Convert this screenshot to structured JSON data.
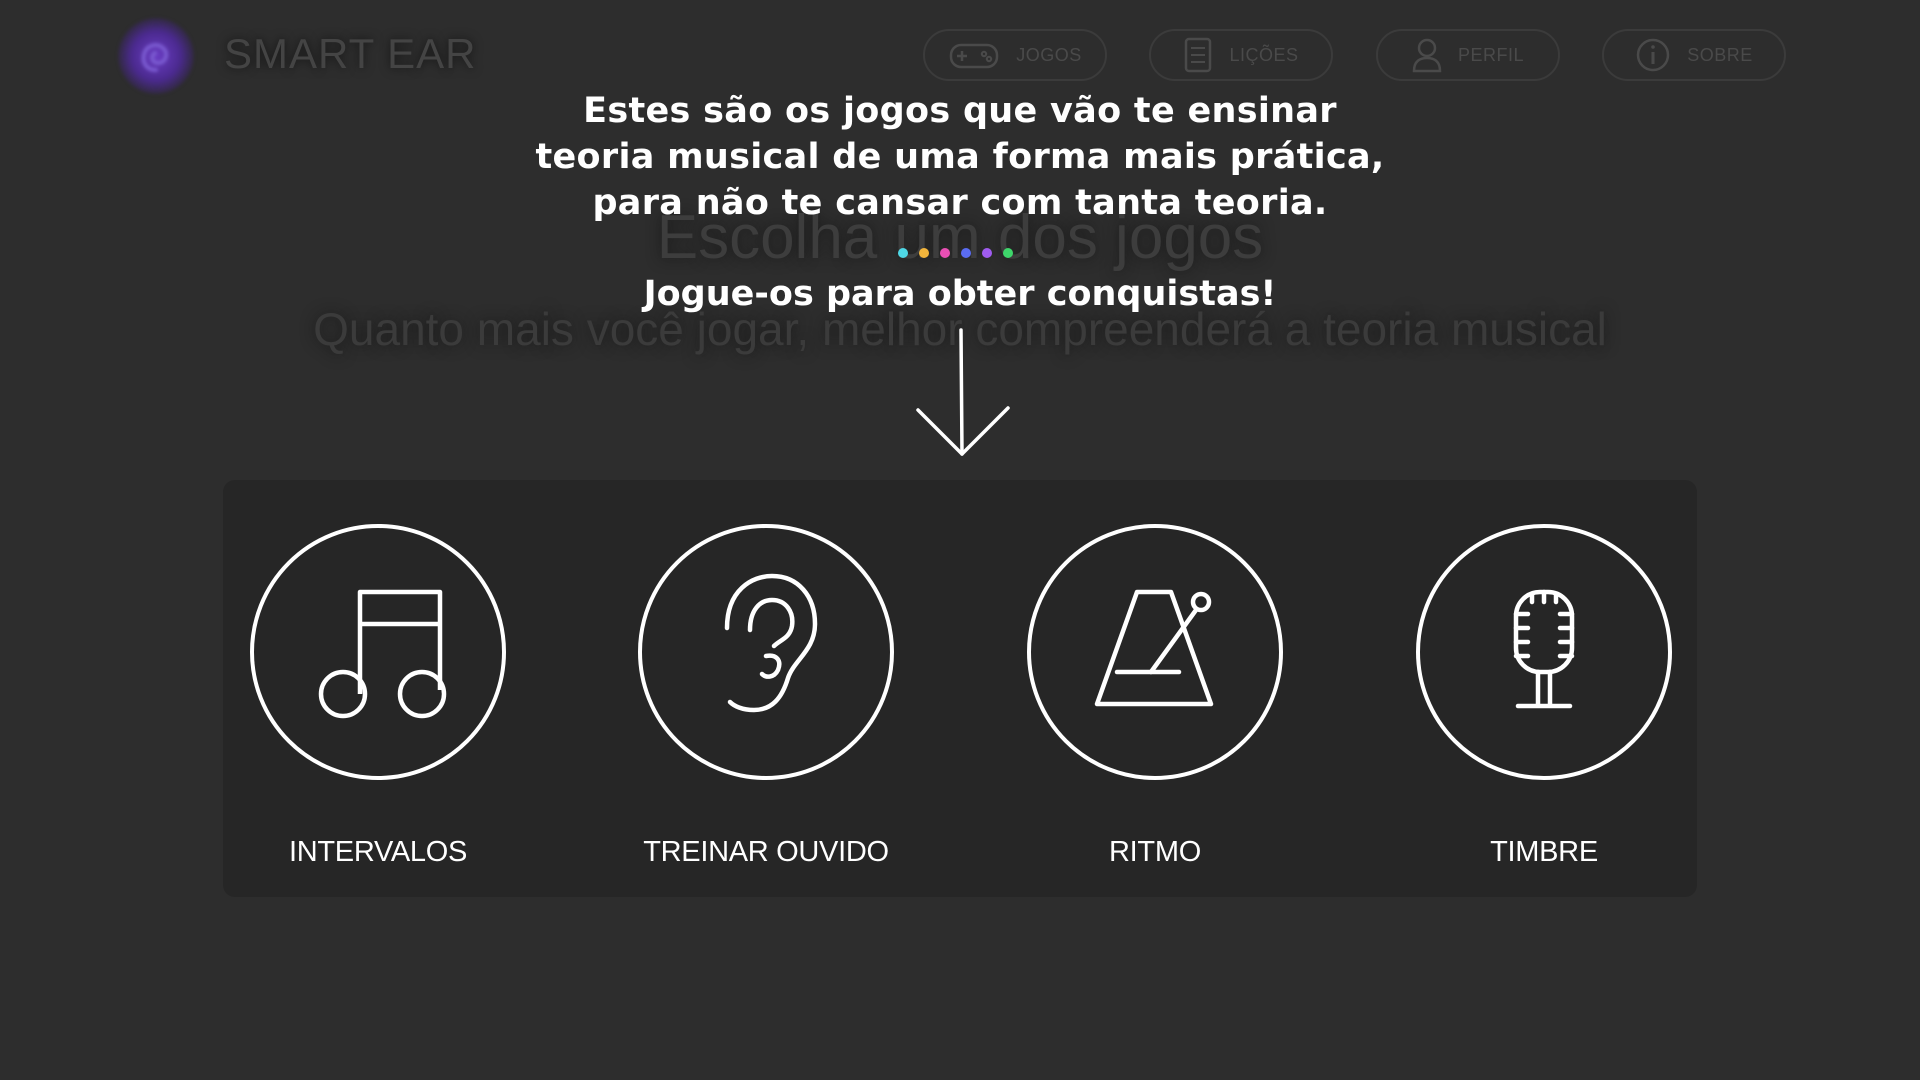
{
  "app": {
    "title": "SMART EAR"
  },
  "nav": [
    {
      "label": "JOGOS",
      "icon": "gamepad-icon"
    },
    {
      "label": "LIÇÕES",
      "icon": "book-icon"
    },
    {
      "label": "PERFIL",
      "icon": "user-icon"
    },
    {
      "label": "SOBRE",
      "icon": "info-icon"
    }
  ],
  "background": {
    "heading": "Escolha um dos jogos",
    "subheading": "Quanto mais você jogar, melhor compreenderá a teoria musical"
  },
  "tooltip": {
    "lines": [
      "Estes são os jogos que vão te ensinar",
      "teoria musical de uma forma mais prática,",
      "para não te cansar com tanta teoria."
    ],
    "dot_colors": [
      "#4fd8e6",
      "#f2b53c",
      "#e94fb4",
      "#5a6cf2",
      "#a05cf0",
      "#3ed66b"
    ],
    "call_to_action": "Jogue-os para obter conquistas!"
  },
  "games": [
    {
      "label": "INTERVALOS",
      "icon": "music-note-icon"
    },
    {
      "label": "TREINAR OUVIDO",
      "icon": "ear-icon"
    },
    {
      "label": "RITMO",
      "icon": "metronome-icon"
    },
    {
      "label": "TIMBRE",
      "icon": "microphone-icon"
    }
  ]
}
